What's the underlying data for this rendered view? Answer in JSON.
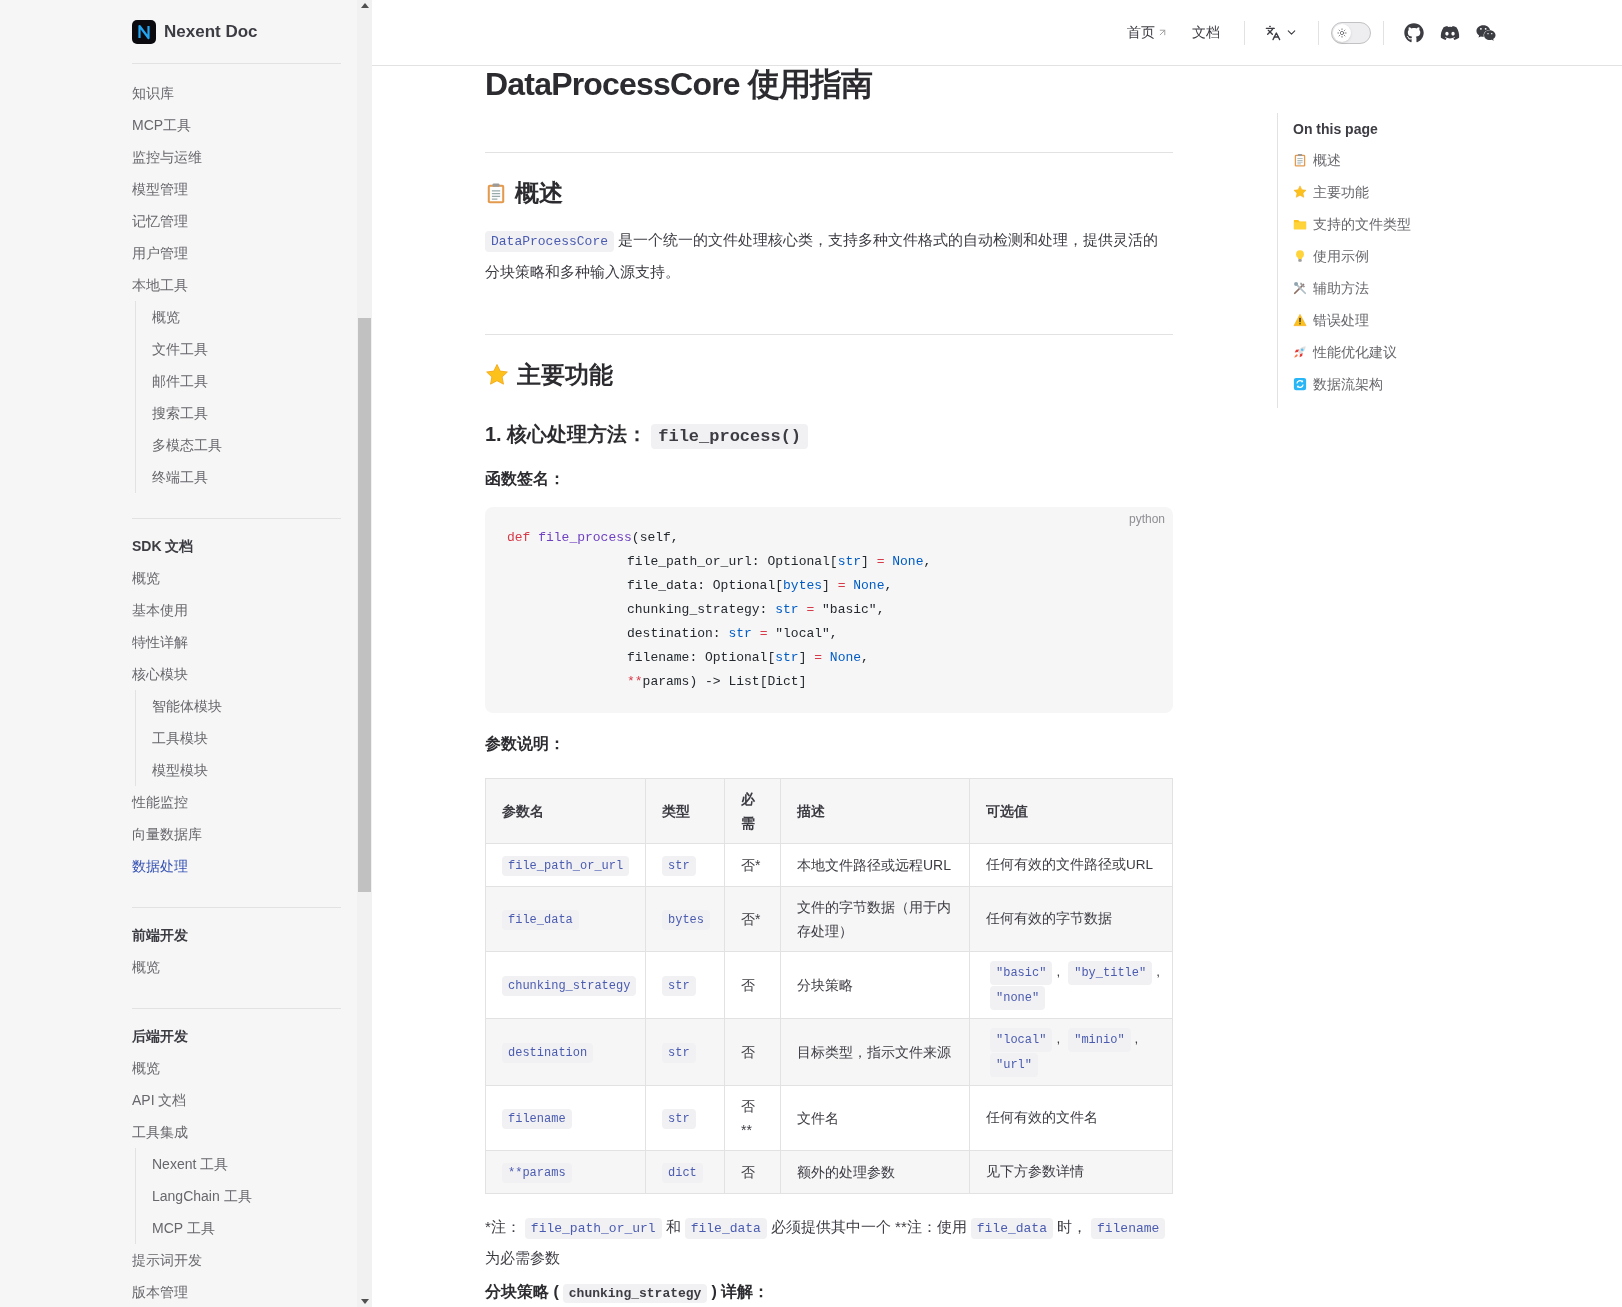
{
  "site": {
    "name": "Nexent Doc"
  },
  "nav": [
    {
      "label": "首页",
      "external": true
    },
    {
      "label": "文档",
      "external": false
    }
  ],
  "theme_toggle": {
    "on": false
  },
  "sidebar": {
    "sections": [
      {
        "items": [
          {
            "label": "知识库",
            "selected": false
          },
          {
            "label": "MCP工具",
            "selected": false
          },
          {
            "label": "监控与运维",
            "selected": false
          },
          {
            "label": "模型管理",
            "selected": false
          },
          {
            "label": "记忆管理",
            "selected": false
          },
          {
            "label": "用户管理",
            "selected": false
          },
          {
            "label": "本地工具",
            "selected": false,
            "children": [
              {
                "label": "概览",
                "selected": false
              },
              {
                "label": "文件工具",
                "selected": false
              },
              {
                "label": "邮件工具",
                "selected": false
              },
              {
                "label": "搜索工具",
                "selected": false
              },
              {
                "label": "多模态工具",
                "selected": false
              },
              {
                "label": "终端工具",
                "selected": false
              }
            ]
          }
        ]
      },
      {
        "title": "SDK 文档",
        "items": [
          {
            "label": "概览",
            "selected": false
          },
          {
            "label": "基本使用",
            "selected": false
          },
          {
            "label": "特性详解",
            "selected": false
          },
          {
            "label": "核心模块",
            "selected": false,
            "children": [
              {
                "label": "智能体模块",
                "selected": false
              },
              {
                "label": "工具模块",
                "selected": false
              },
              {
                "label": "模型模块",
                "selected": false
              }
            ]
          },
          {
            "label": "性能监控",
            "selected": false
          },
          {
            "label": "向量数据库",
            "selected": false
          },
          {
            "label": "数据处理",
            "selected": true
          }
        ]
      },
      {
        "title": "前端开发",
        "items": [
          {
            "label": "概览",
            "selected": false
          }
        ]
      },
      {
        "title": "后端开发",
        "items": [
          {
            "label": "概览",
            "selected": false
          },
          {
            "label": "API 文档",
            "selected": false
          },
          {
            "label": "工具集成",
            "selected": false,
            "children": [
              {
                "label": "Nexent 工具",
                "selected": false
              },
              {
                "label": "LangChain 工具",
                "selected": false
              },
              {
                "label": "MCP 工具",
                "selected": false
              }
            ]
          },
          {
            "label": "提示词开发",
            "selected": false
          },
          {
            "label": "版本管理",
            "selected": false
          }
        ]
      }
    ]
  },
  "article": {
    "title": "DataProcessCore 使用指南",
    "overview": {
      "heading": "概述",
      "kind": "clipboard",
      "paragraph": [
        {
          "kind": "code",
          "text": "DataProcessCore"
        },
        {
          "kind": "text",
          "text": "是一个统一的文件处理核心类，支持多种文件格式的自动检测和处理，提供灵活的分块策略和多种输入源支持。"
        }
      ]
    },
    "features": {
      "heading": "主要功能",
      "kind": "star",
      "subheading": [
        {
          "kind": "text",
          "text": "1. 核心处理方法："
        },
        {
          "kind": "code",
          "text": "file_process()"
        }
      ],
      "signature_label": "函数签名：",
      "code": {
        "language": "python",
        "lines": [
          {
            "indent": false,
            "tokens": [
              {
                "kind": "keyword",
                "text": "def"
              },
              {
                "kind": "function",
                "text": " file_process"
              },
              {
                "kind": "plain",
                "text": "(self,"
              }
            ]
          },
          {
            "indent": true,
            "tokens": [
              {
                "kind": "plain",
                "text": "file_path_or_url: Optional["
              },
              {
                "kind": "builtin",
                "text": "str"
              },
              {
                "kind": "plain",
                "text": "] "
              },
              {
                "kind": "operator",
                "text": "="
              },
              {
                "kind": "builtin",
                "text": " None"
              },
              {
                "kind": "plain",
                "text": ","
              }
            ]
          },
          {
            "indent": true,
            "tokens": [
              {
                "kind": "plain",
                "text": "file_data: Optional["
              },
              {
                "kind": "builtin",
                "text": "bytes"
              },
              {
                "kind": "plain",
                "text": "] "
              },
              {
                "kind": "operator",
                "text": "="
              },
              {
                "kind": "builtin",
                "text": " None"
              },
              {
                "kind": "plain",
                "text": ","
              }
            ]
          },
          {
            "indent": true,
            "tokens": [
              {
                "kind": "plain",
                "text": "chunking_strategy: "
              },
              {
                "kind": "builtin",
                "text": "str"
              },
              {
                "kind": "operator",
                "text": " ="
              },
              {
                "kind": "plain",
                "text": " \"basic\","
              }
            ]
          },
          {
            "indent": true,
            "tokens": [
              {
                "kind": "plain",
                "text": "destination: "
              },
              {
                "kind": "builtin",
                "text": "str"
              },
              {
                "kind": "operator",
                "text": " ="
              },
              {
                "kind": "plain",
                "text": " \"local\","
              }
            ]
          },
          {
            "indent": true,
            "tokens": [
              {
                "kind": "plain",
                "text": "filename: Optional["
              },
              {
                "kind": "builtin",
                "text": "str"
              },
              {
                "kind": "plain",
                "text": "] "
              },
              {
                "kind": "operator",
                "text": "="
              },
              {
                "kind": "builtin",
                "text": " None"
              },
              {
                "kind": "plain",
                "text": ","
              }
            ]
          },
          {
            "indent": true,
            "tokens": [
              {
                "kind": "operator",
                "text": "**"
              },
              {
                "kind": "plain",
                "text": "params) -> List[Dict]"
              }
            ]
          }
        ]
      },
      "params_label": "参数说明：",
      "table": {
        "columns": [
          "参数名",
          "类型",
          "必需",
          "描述",
          "可选值"
        ],
        "rows": [
          {
            "name": "file_path_or_url",
            "type": "str",
            "required": "否*",
            "description": "本地文件路径或远程URL",
            "options": [
              {
                "kind": "text",
                "text": "任何有效的文件路径或URL"
              }
            ]
          },
          {
            "name": "file_data",
            "type": "bytes",
            "required": "否*",
            "description": "文件的字节数据（用于内存处理）",
            "options": [
              {
                "kind": "text",
                "text": "任何有效的字节数据"
              }
            ]
          },
          {
            "name": "chunking_strategy",
            "type": "str",
            "required": "否",
            "description": "分块策略",
            "options": [
              {
                "kind": "code",
                "text": "\"basic\""
              },
              {
                "kind": "text",
                "text": ","
              },
              {
                "kind": "code",
                "text": "\"by_title\""
              },
              {
                "kind": "text",
                "text": ","
              },
              {
                "kind": "code",
                "text": "\"none\""
              }
            ]
          },
          {
            "name": "destination",
            "type": "str",
            "required": "否",
            "description": "目标类型，指示文件来源",
            "options": [
              {
                "kind": "code",
                "text": "\"local\""
              },
              {
                "kind": "text",
                "text": ","
              },
              {
                "kind": "code",
                "text": "\"minio\""
              },
              {
                "kind": "text",
                "text": ","
              },
              {
                "kind": "code",
                "text": "\"url\""
              }
            ]
          },
          {
            "name": "filename",
            "type": "str",
            "required": "否**",
            "description": "文件名",
            "options": [
              {
                "kind": "text",
                "text": "任何有效的文件名"
              }
            ]
          },
          {
            "name": "**params",
            "type": "dict",
            "required": "否",
            "description": "额外的处理参数",
            "options": [
              {
                "kind": "text",
                "text": "见下方参数详情"
              }
            ]
          }
        ]
      },
      "note": [
        {
          "kind": "text",
          "text": "*注："
        },
        {
          "kind": "code",
          "text": "file_path_or_url"
        },
        {
          "kind": "text",
          "text": "和"
        },
        {
          "kind": "code",
          "text": "file_data"
        },
        {
          "kind": "text",
          "text": "必须提供其中一个 **注：使用"
        },
        {
          "kind": "code",
          "text": "file_data"
        },
        {
          "kind": "text",
          "text": "时，"
        },
        {
          "kind": "code",
          "text": "filename"
        },
        {
          "kind": "text",
          "text": "为必需参数"
        }
      ],
      "next_heading": [
        {
          "kind": "text",
          "text": "分块策略 ("
        },
        {
          "kind": "code",
          "text": "chunking_strategy"
        },
        {
          "kind": "text",
          "text": ") 详解："
        }
      ]
    }
  },
  "toc": {
    "title": "On this page",
    "items": [
      {
        "label": "概述",
        "kind": "clipboard"
      },
      {
        "label": "主要功能",
        "kind": "star"
      },
      {
        "label": "支持的文件类型",
        "kind": "folder"
      },
      {
        "label": "使用示例",
        "kind": "bulb"
      },
      {
        "label": "辅助方法",
        "kind": "tools"
      },
      {
        "label": "错误处理",
        "kind": "warning"
      },
      {
        "label": "性能优化建议",
        "kind": "rocket"
      },
      {
        "label": "数据流架构",
        "kind": "sync"
      }
    ]
  }
}
